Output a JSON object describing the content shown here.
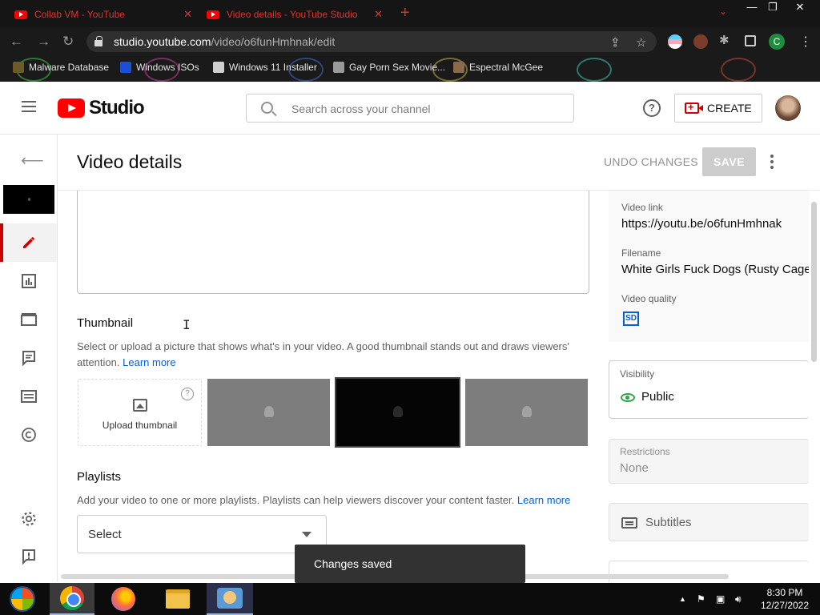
{
  "browser": {
    "tabs": [
      {
        "title": "Collab VM - YouTube",
        "close": "✕"
      },
      {
        "title": "Video details - YouTube Studio",
        "close": "✕"
      }
    ],
    "new_tab": "+",
    "url_host": "studio.youtube.com",
    "url_path": "/video/o6funHmhnak/edit",
    "window_controls": {
      "minimize": "—",
      "maximize": "❐",
      "close": "✕"
    },
    "profile_initial": "C",
    "bookmarks": [
      {
        "label": "Malware Database",
        "color": "#6b5a2a"
      },
      {
        "label": "Windows ISOs",
        "color": "#1a4fd6"
      },
      {
        "label": "Windows 11 Installer",
        "color": "#cfcfcf"
      },
      {
        "label": "Gay Porn Sex Movie...",
        "color": "#9a9a9a"
      },
      {
        "label": "Espectral McGee",
        "color": "#8a6a4a"
      }
    ]
  },
  "studio": {
    "logo_text": "Studio",
    "search_placeholder": "Search across your channel",
    "help_glyph": "?",
    "create_label": "CREATE"
  },
  "page": {
    "title": "Video details",
    "undo_label": "UNDO CHANGES",
    "save_label": "SAVE"
  },
  "thumbnail": {
    "title": "Thumbnail",
    "description": "Select or upload a picture that shows what's in your video. A good thumbnail stands out and draws viewers' attention.",
    "learn_more": "Learn more",
    "upload_label": "Upload thumbnail",
    "help_glyph": "?"
  },
  "playlists": {
    "title": "Playlists",
    "description": "Add your video to one or more playlists. Playlists can help viewers discover your content faster.",
    "learn_more": "Learn more",
    "select_value": "Select"
  },
  "details": {
    "video_link_label": "Video link",
    "video_link": "https://youtu.be/o6funHmhnak",
    "filename_label": "Filename",
    "filename": "White Girls Fuck Dogs (Rusty Cage",
    "quality_label": "Video quality",
    "quality_badge": "SD"
  },
  "visibility": {
    "label": "Visibility",
    "value": "Public"
  },
  "restrictions": {
    "label": "Restrictions",
    "value": "None"
  },
  "subtitles": {
    "label": "Subtitles"
  },
  "snackbar": {
    "message": "Changes saved"
  },
  "taskbar": {
    "time": "8:30 PM",
    "date": "12/27/2022",
    "tray_glyph": "▲"
  },
  "colors": {
    "accent_red": "#cc0000",
    "link_blue": "#065fd4",
    "public_green": "#2ba640"
  }
}
